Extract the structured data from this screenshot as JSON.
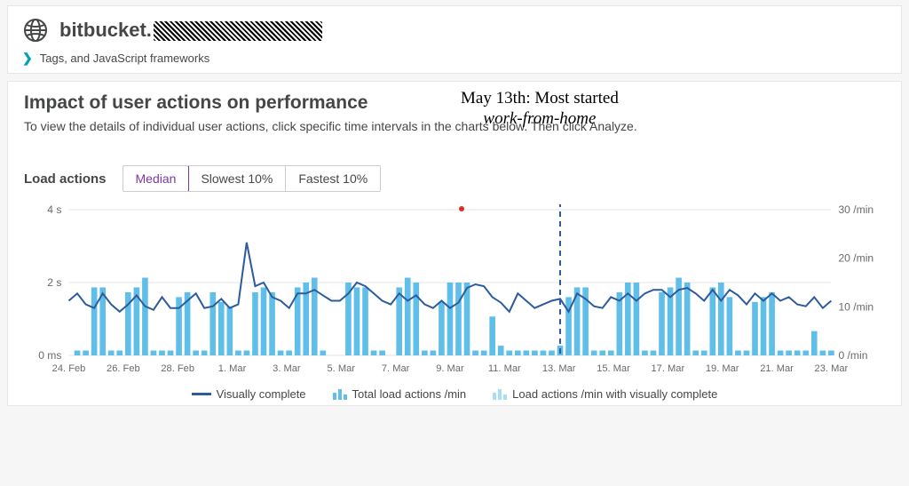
{
  "header": {
    "app_name": "bitbucket.",
    "breadcrumb": "Tags, and JavaScript frameworks"
  },
  "panel": {
    "title": "Impact of user actions on performance",
    "description": "To view the details of individual user actions, click specific time intervals in the charts below. Then click Analyze.",
    "controls": {
      "label": "Load actions",
      "median": "Median",
      "slowest": "Slowest 10%",
      "fastest": "Fastest 10%"
    }
  },
  "annotation": {
    "line1": "May 13th: Most started",
    "line2": "work-from-home"
  },
  "axes": {
    "left": {
      "top": "4 s",
      "mid": "2 s",
      "bottom": "0 ms"
    },
    "right": {
      "top": "30 /min",
      "mid2": "20 /min",
      "mid1": "10 /min",
      "bottom": "0 /min"
    }
  },
  "legend": {
    "line": "Visually complete",
    "bars_solid": "Total load actions /min",
    "bars_light": "Load actions /min with visually complete"
  },
  "chart_data": {
    "type": "bar+line",
    "title": "Load actions — Median",
    "xlabel": "",
    "ylabel_left": "Visually complete (ms)",
    "ylabel_right": "/min",
    "ylim_left": [
      0,
      4000
    ],
    "ylim_right": [
      0,
      30
    ],
    "x_tick_labels": [
      "24. Feb",
      "26. Feb",
      "28. Feb",
      "1. Mar",
      "3. Mar",
      "5. Mar",
      "7. Mar",
      "9. Mar",
      "11. Mar",
      "13. Mar",
      "15. Mar",
      "17. Mar",
      "19. Mar",
      "21. Mar",
      "23. Mar"
    ],
    "annotation_x": "13. Mar",
    "series": [
      {
        "name": "Visually complete",
        "axis": "left",
        "type": "line",
        "values": [
          1500,
          1700,
          1400,
          1300,
          1700,
          1400,
          1200,
          1400,
          1650,
          1350,
          1250,
          1600,
          1300,
          1300,
          1500,
          1700,
          1300,
          1350,
          1550,
          1300,
          1400,
          3100,
          1900,
          2000,
          1600,
          1500,
          1300,
          1700,
          1700,
          1800,
          1650,
          1500,
          1500,
          1700,
          2000,
          1900,
          1700,
          1500,
          1400,
          1700,
          1500,
          1650,
          1400,
          1300,
          1500,
          1300,
          1450,
          1850,
          1950,
          1900,
          1600,
          1450,
          1200,
          1700,
          1500,
          1300,
          1400,
          1500,
          1550,
          1200,
          1700,
          1550,
          1350,
          1300,
          1600,
          1500,
          1700,
          1500,
          1700,
          1800,
          1800,
          1600,
          1800,
          1850,
          1700,
          1500,
          1800,
          1500,
          1800,
          1650,
          1400,
          1700,
          1500,
          1700,
          1500,
          1600,
          1400,
          1350,
          1600,
          1300,
          1500
        ]
      },
      {
        "name": "Total load actions /min",
        "axis": "right",
        "type": "bar",
        "values": [
          0,
          1,
          1,
          14,
          14,
          1,
          1,
          13,
          14,
          16,
          1,
          1,
          1,
          12,
          13,
          1,
          1,
          13,
          11,
          10,
          1,
          1,
          13,
          14,
          13,
          1,
          1,
          14,
          15,
          16,
          1,
          0,
          0,
          15,
          14,
          14,
          1,
          1,
          0,
          14,
          16,
          15,
          1,
          1,
          11,
          15,
          15,
          15,
          1,
          1,
          8,
          2,
          1,
          1,
          1,
          1,
          1,
          1,
          2,
          12,
          14,
          14,
          1,
          1,
          1,
          13,
          15,
          15,
          1,
          1,
          13,
          14,
          16,
          15,
          1,
          1,
          14,
          15,
          12,
          1,
          1,
          11,
          12,
          13,
          1,
          1,
          1,
          1,
          5,
          1,
          1
        ]
      },
      {
        "name": "Load actions /min with visually complete",
        "axis": "right",
        "type": "bar",
        "values": [
          0,
          1,
          1,
          1,
          1,
          1,
          1,
          1,
          1,
          1,
          1,
          1,
          1,
          1,
          1,
          1,
          1,
          1,
          1,
          1,
          1,
          1,
          1,
          1,
          1,
          1,
          1,
          1,
          1,
          1,
          1,
          0,
          0,
          1,
          1,
          1,
          1,
          1,
          0,
          1,
          1,
          1,
          1,
          1,
          1,
          1,
          1,
          1,
          1,
          1,
          1,
          1,
          1,
          1,
          1,
          1,
          1,
          1,
          1,
          1,
          1,
          1,
          1,
          1,
          1,
          1,
          1,
          1,
          1,
          1,
          1,
          1,
          1,
          1,
          1,
          1,
          1,
          1,
          1,
          1,
          1,
          1,
          1,
          1,
          1,
          1,
          1,
          1,
          1,
          1,
          1
        ]
      }
    ]
  }
}
